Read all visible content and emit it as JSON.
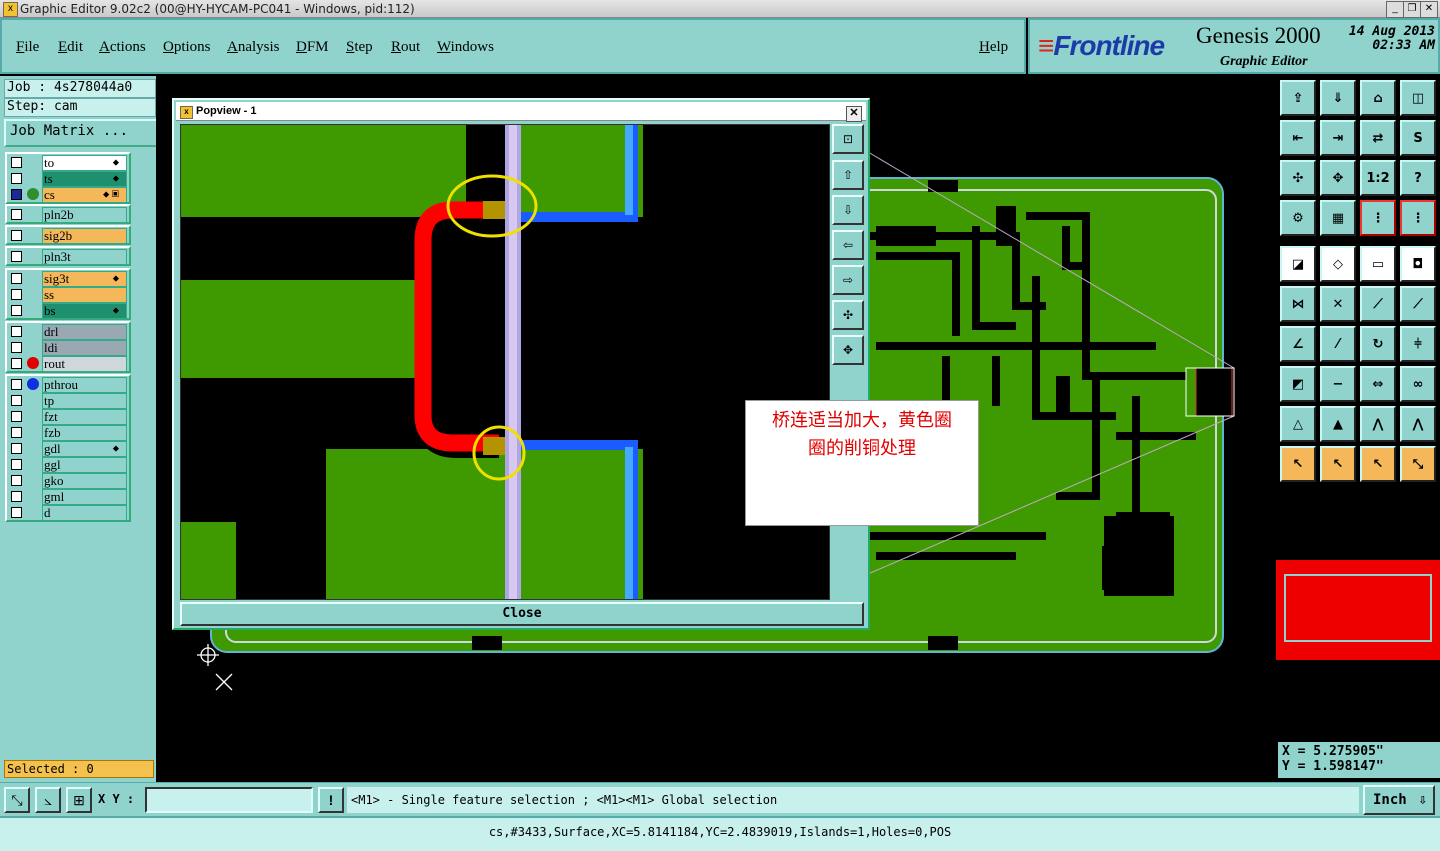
{
  "window": {
    "title": "Graphic Editor 9.02c2 (00@HY-HYCAM-PC041 - Windows, pid:112)",
    "app_icon": "x-app-icon",
    "min_icon": "_",
    "max_icon": "❐",
    "close_icon": "✕"
  },
  "menu": {
    "items": [
      "File",
      "Edit",
      "Actions",
      "Options",
      "Analysis",
      "DFM",
      "Step",
      "Rout",
      "Windows"
    ],
    "help": "Help"
  },
  "logo": {
    "brand": "Frontline",
    "product": "Genesis 2000",
    "subtitle": "Graphic Editor",
    "date": "14 Aug 2013",
    "time": "02:33 AM"
  },
  "job": {
    "job": "Job : 4s278044a0",
    "step": "Step: cam",
    "matrix_button": "Job Matrix ..."
  },
  "layers": {
    "group1": [
      {
        "name": "to",
        "color": "#ffffff",
        "aff": "⬥",
        "dot": ""
      },
      {
        "name": "ts",
        "color": "#1e9070",
        "aff": "⬥",
        "dot": ""
      },
      {
        "name": "cs",
        "color": "#f4b85a",
        "aff": "⬥ ▣",
        "dot": "#2f8f2f",
        "selected": true
      }
    ],
    "group2": [
      {
        "name": "pln2b",
        "color": "#8fd3cc"
      }
    ],
    "group3": [
      {
        "name": "sig2b",
        "color": "#f4b85a"
      }
    ],
    "group4": [
      {
        "name": "pln3t",
        "color": "#8fd3cc"
      }
    ],
    "group5": [
      {
        "name": "sig3t",
        "color": "#f4b85a",
        "aff": "⬥"
      },
      {
        "name": "ss",
        "color": "#f4b85a"
      },
      {
        "name": "bs",
        "color": "#1e9070",
        "aff": "⬥"
      }
    ],
    "group6": [
      {
        "name": "drl",
        "color": "#9aa8b4"
      },
      {
        "name": "ldi",
        "color": "#9aa8b4"
      },
      {
        "name": "rout",
        "color": "#cfd6dc",
        "dot": "#e00000"
      }
    ],
    "group7": [
      {
        "name": "pthrou",
        "color": "#8fd3cc",
        "dot": "#1030e0"
      },
      {
        "name": "tp",
        "color": "#8fd3cc"
      },
      {
        "name": "fzt",
        "color": "#8fd3cc"
      },
      {
        "name": "fzb",
        "color": "#8fd3cc"
      },
      {
        "name": "gdl",
        "color": "#8fd3cc",
        "aff": "⬥"
      },
      {
        "name": "ggl",
        "color": "#8fd3cc"
      },
      {
        "name": "gko",
        "color": "#8fd3cc"
      },
      {
        "name": "gml",
        "color": "#8fd3cc"
      },
      {
        "name": "d",
        "color": "#8fd3cc"
      }
    ]
  },
  "selected_count": "Selected : 0",
  "popview": {
    "title": "Popview - 1",
    "close_label": "Close",
    "close_icon": "✕"
  },
  "annotation": {
    "line1": "桥连适当加大，黄色圈",
    "line2": "圈的削铜处理"
  },
  "coords": {
    "x": "X =  5.275905\"",
    "y": "Y =  1.598147\""
  },
  "bottom": {
    "xy_label": "X Y :",
    "xy_value": "",
    "warn_icon": "!",
    "message": "<M1> - Single feature selection ; <M1><M1> Global selection",
    "unit": "Inch"
  },
  "status": "cs,#3433,Surface,XC=5.8141184,YC=2.4839019,Islands=1,Holes=0,POS",
  "colors": {
    "teal": "#8fd3cc",
    "green_copper": "#3e9a00",
    "route_red": "#ff0000",
    "highlight_yellow": "#f0e000",
    "blue_trace": "#1a5cff",
    "light_blue_trace": "#44aaff"
  }
}
